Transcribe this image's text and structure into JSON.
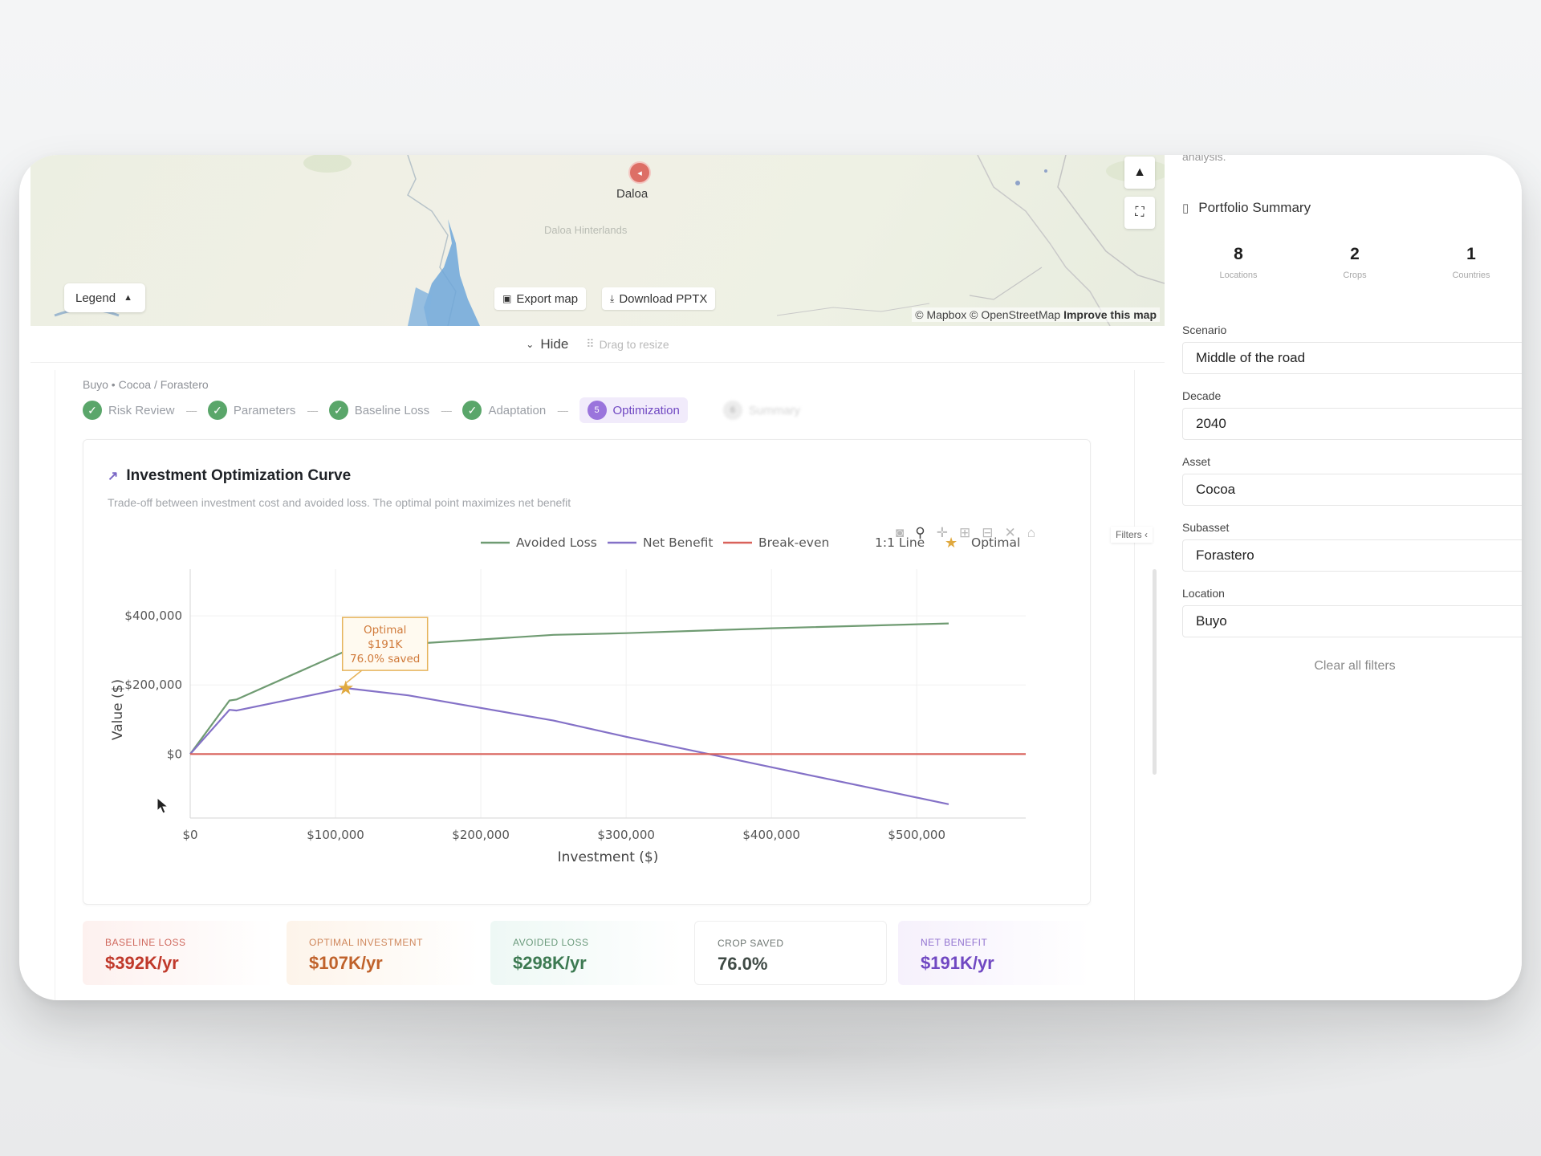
{
  "map": {
    "marker_label": "Daloa",
    "faint_label": "Daloa Hinterlands",
    "legend_label": "Legend",
    "export_label": "Export map",
    "download_label": "Download PPTX",
    "attribution": "© Mapbox © OpenStreetMap",
    "improve_label": "Improve this map"
  },
  "hide_bar": {
    "hide_label": "Hide",
    "drag_label": "Drag to resize"
  },
  "breadcrumb": "Buyo • Cocoa / Forastero",
  "stepper": {
    "steps": [
      {
        "label": "Risk Review",
        "state": "done"
      },
      {
        "label": "Parameters",
        "state": "done"
      },
      {
        "label": "Baseline Loss",
        "state": "done"
      },
      {
        "label": "Adaptation",
        "state": "done"
      },
      {
        "label": "Optimization",
        "state": "active",
        "number": "5"
      },
      {
        "label": "Summary",
        "state": "pending",
        "number": "6"
      }
    ]
  },
  "chart_card": {
    "title": "Investment Optimization Curve",
    "subtitle": "Trade-off between investment cost and avoided loss. The optimal point maximizes net benefit"
  },
  "chart_data": {
    "type": "line",
    "xlabel": "Investment ($)",
    "ylabel": "Value ($)",
    "xlim": [
      0,
      575000
    ],
    "ylim": [
      -185000,
      535000
    ],
    "x_ticks": [
      0,
      100000,
      200000,
      300000,
      400000,
      500000
    ],
    "x_tick_labels": [
      "$0",
      "$100,000",
      "$200,000",
      "$300,000",
      "$400,000",
      "$500,000"
    ],
    "y_ticks": [
      0,
      200000,
      400000
    ],
    "y_tick_labels": [
      "$0",
      "$200,000",
      "$400,000"
    ],
    "legend": [
      "Avoided Loss",
      "Net Benefit",
      "Break-even",
      "1:1 Line",
      "Optimal"
    ],
    "legend_position": "top-right",
    "series": [
      {
        "name": "Avoided Loss",
        "color": "#6f9b72",
        "points": [
          [
            0,
            0
          ],
          [
            27000,
            155000
          ],
          [
            32000,
            158000
          ],
          [
            107000,
            298000
          ],
          [
            150000,
            318000
          ],
          [
            250000,
            345000
          ],
          [
            300000,
            350000
          ],
          [
            400000,
            364000
          ],
          [
            522000,
            378000
          ]
        ]
      },
      {
        "name": "Net Benefit",
        "color": "#8471c7",
        "points": [
          [
            0,
            0
          ],
          [
            27000,
            128000
          ],
          [
            32000,
            126000
          ],
          [
            107000,
            191000
          ],
          [
            150000,
            170000
          ],
          [
            250000,
            97000
          ],
          [
            300000,
            50000
          ],
          [
            357000,
            0
          ],
          [
            400000,
            -38000
          ],
          [
            522000,
            -145000
          ]
        ]
      },
      {
        "name": "Break-even",
        "color": "#d9625b",
        "points": [
          [
            0,
            0
          ],
          [
            575000,
            0
          ]
        ]
      }
    ],
    "optimal": {
      "x": 107000,
      "y": 191000,
      "label_lines": [
        "Optimal",
        "$191K",
        "76.0% saved"
      ]
    }
  },
  "toolbar_icons": [
    "camera-icon",
    "zoom-icon",
    "pan-icon",
    "zoom-in-icon",
    "zoom-out-icon",
    "autoscale-icon",
    "home-icon"
  ],
  "filters_tab": "Filters ‹",
  "kpis": [
    {
      "label": "BASELINE LOSS",
      "value": "$392K/yr",
      "color": "#c0392b",
      "bg": "#fdf1ef"
    },
    {
      "label": "OPTIMAL INVESTMENT",
      "value": "$107K/yr",
      "color": "#c0622b",
      "bg": "#fdf4ea"
    },
    {
      "label": "AVOIDED LOSS",
      "value": "$298K/yr",
      "color": "#3d7a52",
      "bg": "#eef8f5"
    },
    {
      "label": "CROP SAVED",
      "value": "76.0%",
      "color": "#3f4a45",
      "bg": "#ffffff"
    },
    {
      "label": "NET BENEFIT",
      "value": "$191K/yr",
      "color": "#7048c2",
      "bg": "#f6f1fc"
    }
  ],
  "sidebar": {
    "top_text": "analysis.",
    "portfolio_title": "Portfolio Summary",
    "stats": [
      {
        "value": "8",
        "label": "Locations"
      },
      {
        "value": "2",
        "label": "Crops"
      },
      {
        "value": "1",
        "label": "Countries"
      }
    ],
    "filters": [
      {
        "label": "Scenario",
        "value": "Middle of the road"
      },
      {
        "label": "Decade",
        "value": "2040"
      },
      {
        "label": "Asset",
        "value": "Cocoa"
      },
      {
        "label": "Subasset",
        "value": "Forastero"
      },
      {
        "label": "Location",
        "value": "Buyo"
      }
    ],
    "clear_label": "Clear all filters"
  }
}
